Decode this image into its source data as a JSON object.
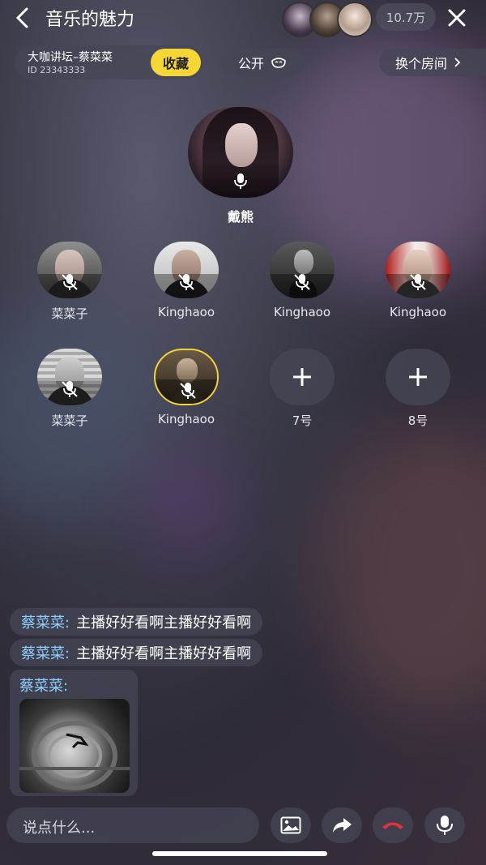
{
  "header": {
    "title": "音乐的魅力",
    "audience_count": "10.7万"
  },
  "room": {
    "name": "大咖讲坛–蔡菜菜",
    "id": "ID 23343333",
    "favorite_label": "收藏",
    "public_label": "公开",
    "change_room_label": "换个房间"
  },
  "host": {
    "name": "戴熊"
  },
  "seats": [
    {
      "name": "菜菜子"
    },
    {
      "name": "Kinghaoo"
    },
    {
      "name": "Kinghaoo"
    },
    {
      "name": "Kinghaoo"
    },
    {
      "name": "菜菜子"
    },
    {
      "name": "Kinghaoo"
    },
    {
      "name": "7号"
    },
    {
      "name": "8号"
    }
  ],
  "chat": [
    {
      "user": "蔡菜菜:",
      "text": "主播好好看啊主播好好看啊"
    },
    {
      "user": "蔡菜菜:",
      "text": "主播好好看啊主播好好看啊"
    },
    {
      "user": "蔡菜菜:"
    }
  ],
  "input": {
    "placeholder": "说点什么..."
  },
  "colors": {
    "accent": "#f5d635",
    "username": "#8fd0ff",
    "hangup": "#e0313d"
  },
  "icons": [
    "back-icon",
    "close-icon",
    "mask-icon",
    "chevron-right-icon",
    "mic-icon",
    "mic-off-icon",
    "plus-icon",
    "image-icon",
    "share-icon",
    "hangup-icon"
  ]
}
